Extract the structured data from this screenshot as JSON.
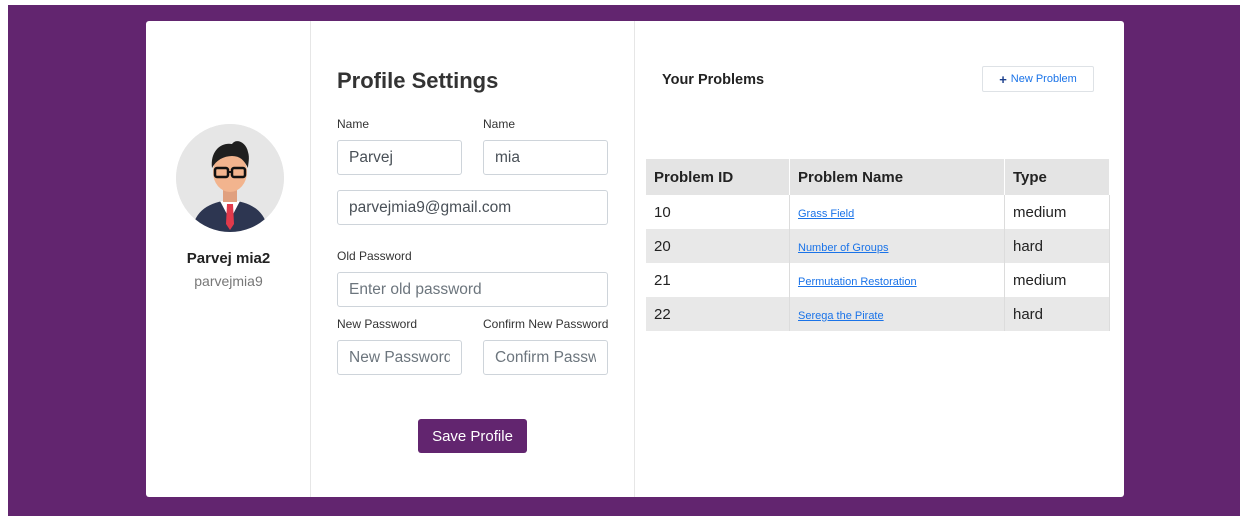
{
  "profile": {
    "display_name": "Parvej mia2",
    "username": "parvejmia9"
  },
  "settings": {
    "title": "Profile Settings",
    "first_name_label": "Name",
    "last_name_label": "Name",
    "first_name_value": "Parvej",
    "last_name_value": "mia",
    "email_value": "parvejmia9@gmail.com",
    "old_password_label": "Old Password",
    "old_password_placeholder": "Enter old password",
    "new_password_label": "New Password",
    "new_password_placeholder": "New Password",
    "confirm_password_label": "Confirm New Password",
    "confirm_password_placeholder": "Confirm Password",
    "save_label": "Save Profile"
  },
  "problems": {
    "title": "Your Problems",
    "new_button_label": "New Problem",
    "headers": {
      "id": "Problem ID",
      "name": "Problem Name",
      "type": "Type"
    },
    "rows": [
      {
        "id": "10",
        "name": "Grass Field",
        "type": "medium"
      },
      {
        "id": "20",
        "name": "Number of Groups",
        "type": "hard"
      },
      {
        "id": "21",
        "name": "Permutation Restoration",
        "type": "medium"
      },
      {
        "id": "22",
        "name": "Serega the Pirate",
        "type": "hard"
      }
    ]
  },
  "colors": {
    "brand_purple": "#62256f",
    "link_blue": "#1a73e8"
  }
}
